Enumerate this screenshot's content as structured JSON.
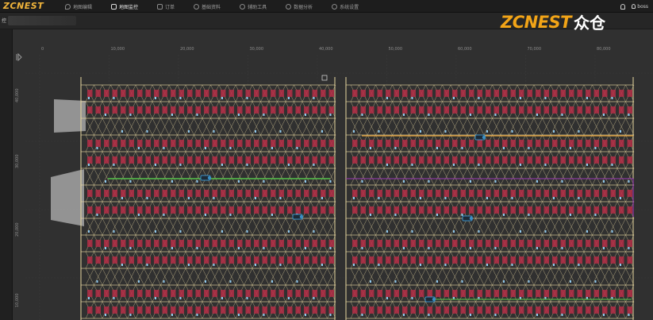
{
  "app": {
    "logo_text": "ZCNEST"
  },
  "nav": {
    "items": [
      {
        "label": "地图编辑",
        "icon": "map-pin-icon",
        "active": false
      },
      {
        "label": "地图监控",
        "icon": "monitor-icon",
        "active": true
      },
      {
        "label": "订单",
        "icon": "document-icon",
        "active": false
      },
      {
        "label": "基础资料",
        "icon": "gear-icon",
        "active": false
      },
      {
        "label": "辅助工具",
        "icon": "gear-icon",
        "active": false
      },
      {
        "label": "数据分析",
        "icon": "gear-icon",
        "active": false
      },
      {
        "label": "系统设置",
        "icon": "gear-icon",
        "active": false
      }
    ]
  },
  "user": {
    "name": "boss"
  },
  "brand": {
    "latin": "ZCNEST",
    "cjk": "众仓"
  },
  "subbar": {
    "label": "控"
  },
  "ruler": {
    "x_ticks": [
      "0",
      "10,000",
      "20,000",
      "30,000",
      "40,000",
      "50,000",
      "60,000",
      "70,000",
      "80,000"
    ],
    "y_ticks": [
      "40,000",
      "30,000",
      "20,000",
      "10,000"
    ]
  },
  "colors": {
    "rack": "#b32d45",
    "path": "#e8d79f",
    "path_highlight_green": "#55c24a",
    "path_highlight_orange": "#e8a23b",
    "path_highlight_purple": "#9b3ab5",
    "robot": "#3b8fc4",
    "station": "#b4b4b4",
    "accent": "#f2a417"
  }
}
